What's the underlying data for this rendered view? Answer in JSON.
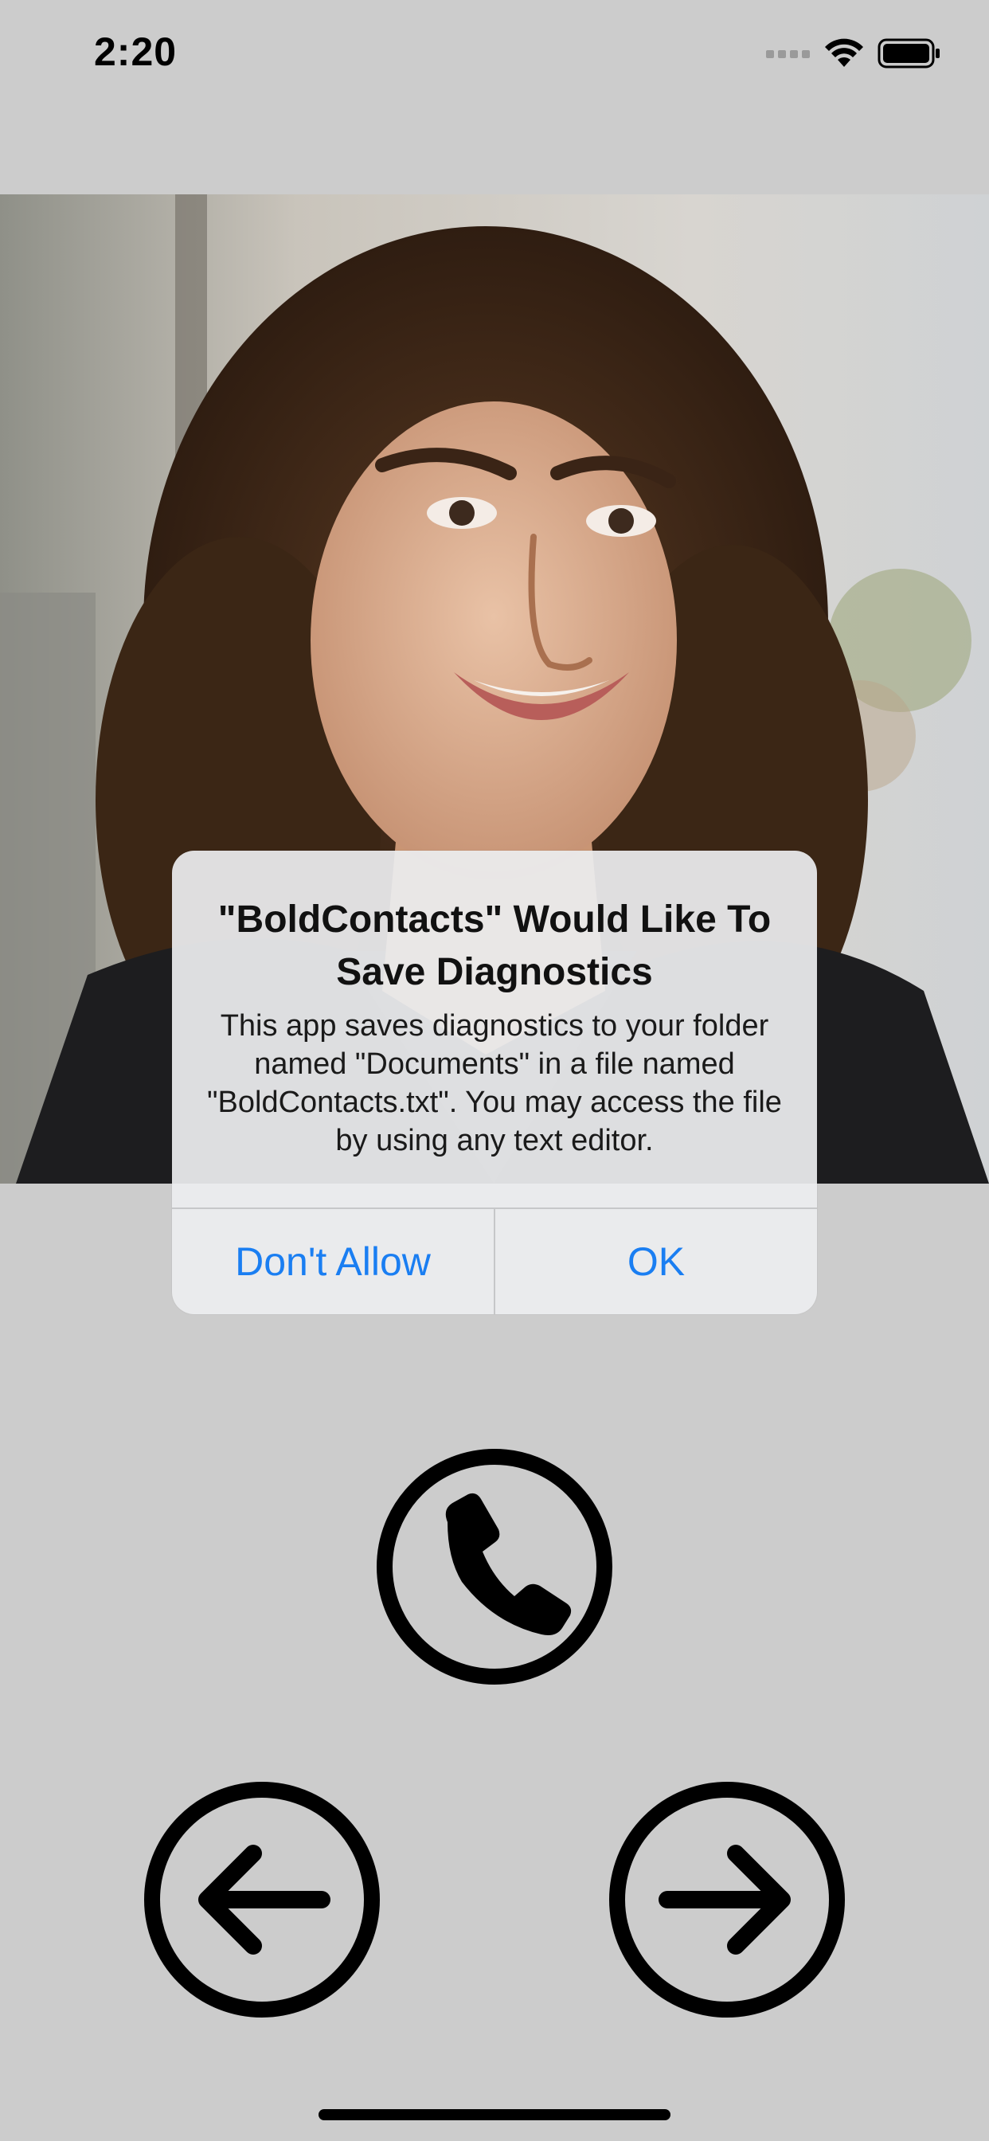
{
  "status_bar": {
    "time": "2:20",
    "icons": [
      "cellular-signal-icon",
      "wifi-icon",
      "battery-icon"
    ]
  },
  "photo": {
    "subject": "contact-photo"
  },
  "alert": {
    "title": "\"BoldContacts\" Would Like To Save Diagnostics",
    "message": "This app saves diagnostics to your folder named \"Documents\" in a file named \"BoldContacts.txt\". You may access the file by using any text editor.",
    "buttons": {
      "deny": "Don't Allow",
      "confirm": "OK"
    },
    "accent_color": "#1a7ef2"
  },
  "controls": {
    "call": "phone-icon",
    "previous": "arrow-left-icon",
    "next": "arrow-right-icon"
  },
  "colors": {
    "background": "#cccccc",
    "icon": "#000000"
  }
}
